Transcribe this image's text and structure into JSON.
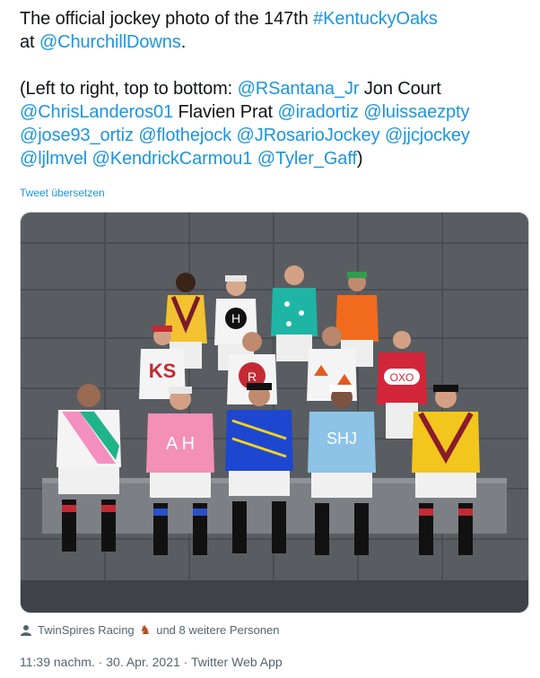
{
  "tweet": {
    "line1_prefix": "The official jockey photo of the 147th ",
    "hashtag": "#KentuckyOaks",
    "line2_prefix": "at ",
    "at_mention": "@ChurchillDowns",
    "line2_suffix": ".",
    "paren_open": "(Left to right, top to bottom: ",
    "mentions": [
      "@RSantana_Jr",
      "@ChrisLanderos01",
      "@iradortiz",
      "@luissaezpty",
      "@jose93_ortiz",
      "@flothejock",
      "@JRosarioJockey",
      "@jjcjockey",
      "@ljlmvel",
      "@KendrickCarmou1",
      "@Tyler_Gaff"
    ],
    "plain_names": [
      " Jon Court",
      " Flavien Prat "
    ],
    "paren_close": ")",
    "translate": "Tweet übersetzen"
  },
  "media": {
    "alt": "jockey group photo"
  },
  "tagged": {
    "account": "TwinSpires Racing",
    "suffix": "und 8 weitere Personen"
  },
  "meta": {
    "time": "11:39 nachm.",
    "sep": " · ",
    "date": "30. Apr. 2021",
    "source": "Twitter Web App"
  },
  "colors": {
    "link": "#1b95e0",
    "muted": "#536471"
  },
  "icons": {
    "tagged": "person-icon",
    "horse": "horse-icon"
  }
}
